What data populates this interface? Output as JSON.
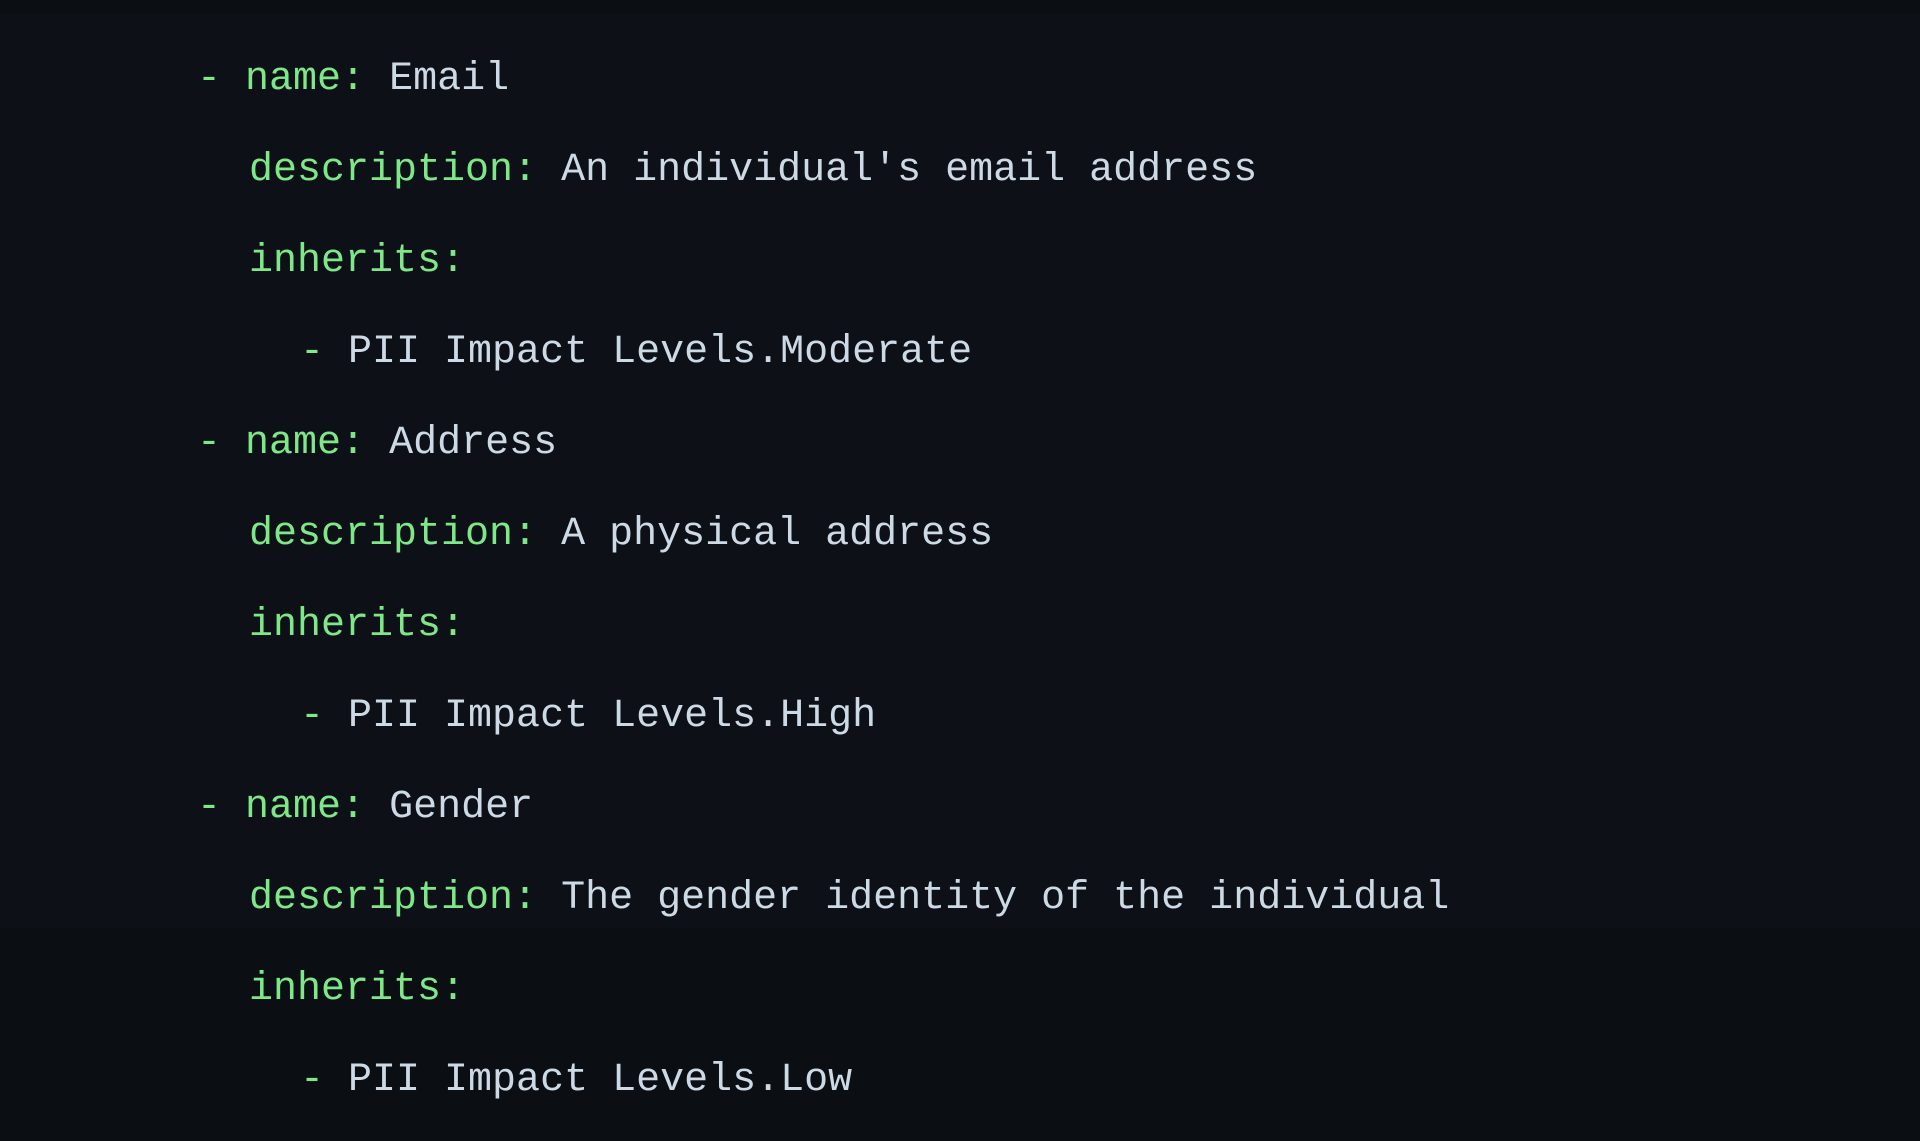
{
  "editor": {
    "language": "yaml",
    "background_color": "#0d1117",
    "key_color": "#7ee787",
    "value_color": "#cdd9e5",
    "dash_color": "#7ee787"
  },
  "keys": {
    "name": "name",
    "description": "description",
    "inherits": "inherits",
    "colon": ":",
    "dash": "-"
  },
  "entries": [
    {
      "name_value": "Email",
      "description_value": "An individual's email address",
      "inherits_items": [
        "PII Impact Levels.Moderate"
      ]
    },
    {
      "name_value": "Address",
      "description_value": "A physical address",
      "inherits_items": [
        "PII Impact Levels.High"
      ]
    },
    {
      "name_value": "Gender",
      "description_value": "The gender identity of the individual",
      "inherits_items": [
        "PII Impact Levels.Low"
      ]
    }
  ]
}
